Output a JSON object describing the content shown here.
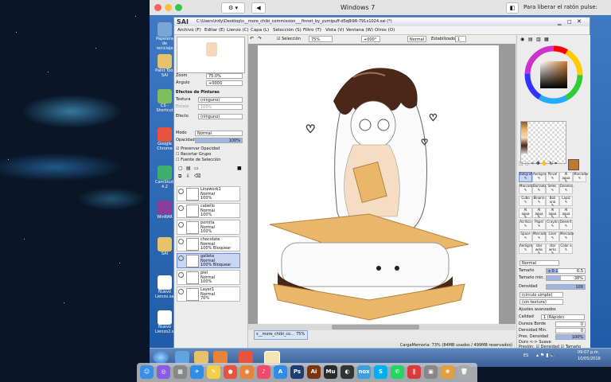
{
  "mac": {
    "window_title": "Windows 7",
    "release_hint": "Para liberar el ratón pulse: Control-⌘"
  },
  "desktop_icons": [
    {
      "label": "Papelera de reciclaje",
      "color": "#7aa6d6"
    },
    {
      "label": "Paint Tool SAI",
      "color": "#e6c26b"
    },
    {
      "label": "CS - Shortcut",
      "color": "#7cbf5c"
    },
    {
      "label": "Google Chrome",
      "color": "#e8533f"
    },
    {
      "label": "CamStudio 4.2",
      "color": "#3fae6f"
    },
    {
      "label": "WinRAR",
      "color": "#8a3d9c"
    },
    {
      "label": "SAI",
      "color": "#e6c26b"
    },
    {
      "label": "Nuevo Lienzo.sai",
      "color": "#ffffff"
    },
    {
      "label": "Nuevo Lienzo2.sai",
      "color": "#ffffff"
    }
  ],
  "sai": {
    "app_name": "SAI",
    "path": "C:\\Users\\indy\\Desktop\\s__more_chibi_commission___finnet_by_yumipuff-d5q8i98-791x1024.sai (*)",
    "menu": [
      "Archivo (F)",
      "Editar (E)",
      "Lienzo (C)",
      "Capa (L)",
      "Selección (S)",
      "Filtro (T)",
      "Vista (V)",
      "Ventana (W)",
      "Otros (O)"
    ],
    "toolbar": {
      "selection_label": "Selección",
      "zoom": "75%",
      "rotation": "+000°",
      "blend_mode": "Normal",
      "stabilizer_label": "Estabilizador",
      "stabilizer_value": "1"
    },
    "navigator": {
      "zoom_label": "Zoom",
      "zoom_value": "75.0%",
      "angle_label": "Ángulo",
      "angle_value": "+0000"
    },
    "paint_effects": {
      "header": "Efectos de Pinturas",
      "texture_label": "Textura",
      "texture_value": "(ninguno)",
      "scale_label": "Escala",
      "scale_value": "100%",
      "effect_label": "Efecto",
      "effect_value": "(ninguno)"
    },
    "layer_props": {
      "mode_label": "Modo",
      "mode_value": "Normal",
      "opacity_label": "Opacidad",
      "opacity_value": "100%",
      "checks": [
        "Preservar Opacidad",
        "Recortar Grupo",
        "Fuente de Selección"
      ]
    },
    "layers": [
      {
        "name": "Linework1",
        "mode": "Normal",
        "opacity": "100%",
        "selected": false
      },
      {
        "name": "cabello",
        "mode": "Normal",
        "opacity": "100%",
        "selected": false
      },
      {
        "name": "pomita",
        "mode": "Normal",
        "opacity": "100%",
        "selected": false
      },
      {
        "name": "chocolate",
        "mode": "Normal",
        "opacity": "100% Bloquear",
        "selected": false
      },
      {
        "name": "galleta",
        "mode": "Normal",
        "opacity": "100% Bloquear",
        "selected": true
      },
      {
        "name": "piel",
        "mode": "Normal",
        "opacity": "100%",
        "selected": false
      },
      {
        "name": "Layer1",
        "mode": "Normal",
        "opacity": "70%",
        "selected": false
      }
    ],
    "tools": [
      [
        "Bolígrafo",
        "Aerógraf",
        "Pincel",
        "Al agua",
        "Marcador"
      ],
      [
        "Marcador",
        "Borrador",
        "Selec.",
        "Deselec.",
        ""
      ],
      [
        "Cubo",
        "Binario",
        "Boli una",
        "Lapiz",
        ""
      ],
      [
        "Al agua",
        "Al agua",
        "Al agua",
        "Al agua",
        ""
      ],
      [
        "Acrílico",
        "Papel",
        "Crayón",
        "Desenf.",
        ""
      ],
      [
        "Space",
        "Mercado",
        "Liner",
        "Mercado",
        ""
      ],
      [
        "Aerógraf",
        "star wrks",
        "star wrks",
        "Color a",
        ""
      ]
    ],
    "brush": {
      "mode": "Normal",
      "size_label": "Tamaño",
      "size_mult": "x 0.1",
      "size_value": "6.5",
      "min_size_label": "Tamaño min.",
      "min_size_value": "38%",
      "density_label": "Densidad",
      "density_value": "100",
      "shape": "(círculo simple)",
      "texture": "(sin textura)",
      "advanced_header": "Ajustes avanzados",
      "quality_label": "Calidad",
      "quality_value": "1 (Rápido)",
      "edge_label": "Dureza Borde",
      "edge_value": "0",
      "min_density_label": "Densidad Min.",
      "min_density_value": "0",
      "max_density_label": "Pres. Densidad",
      "max_density_value": "100%",
      "hard_soft": "Duro <-> Suave",
      "pressure_label": "Presión:",
      "pressure_checks": [
        "Densidad",
        "Tamaño"
      ]
    },
    "doc_tab": {
      "name": "s__more_chibi_co...",
      "zoom": "75%"
    },
    "status": "CargaMemoria: 73% (84MB usados / 499MB reservados)"
  },
  "taskbar": {
    "lang": "ES",
    "time": "09:07 p.m.",
    "date": "10/05/2018"
  },
  "dock_apps": [
    "Finder",
    "Siri",
    "Launchpad",
    "Safari",
    "Notes",
    "Chrome",
    "Firefox",
    "iTunes",
    "App Store",
    "Photoshop",
    "Illustrator",
    "Muse",
    "Dashboard",
    "NOX",
    "Skype",
    "WhatsApp",
    "Parallels",
    "Preview",
    "Photos",
    "Trash"
  ],
  "colors": {
    "accent": "#6a8bd6",
    "selected_layer": "#c8d6f4",
    "win7_blue": "#3f79c1"
  }
}
